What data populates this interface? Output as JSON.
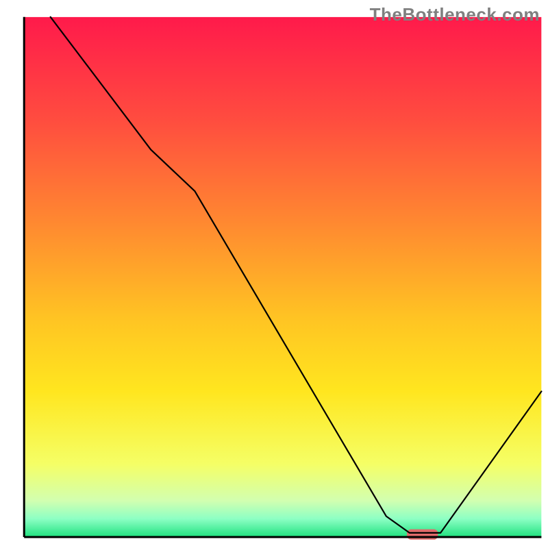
{
  "watermark": "TheBottleneck.com",
  "chart_data": {
    "type": "line",
    "title": "",
    "xlabel": "",
    "ylabel": "",
    "xlim": [
      0,
      100
    ],
    "ylim": [
      0,
      100
    ],
    "background_gradient": {
      "stops": [
        {
          "offset": 0.0,
          "color": "#ff1a4b"
        },
        {
          "offset": 0.2,
          "color": "#ff4d3f"
        },
        {
          "offset": 0.4,
          "color": "#ff8a30"
        },
        {
          "offset": 0.58,
          "color": "#ffc423"
        },
        {
          "offset": 0.72,
          "color": "#ffe61f"
        },
        {
          "offset": 0.86,
          "color": "#f5ff66"
        },
        {
          "offset": 0.93,
          "color": "#d2ffb0"
        },
        {
          "offset": 0.965,
          "color": "#8dffc4"
        },
        {
          "offset": 1.0,
          "color": "#1fe27f"
        }
      ]
    },
    "series": [
      {
        "name": "bottleneck-curve",
        "color": "#000000",
        "x": [
          5.1,
          24.5,
          33.0,
          70.0,
          74.5,
          80.5,
          100.0
        ],
        "values": [
          100.0,
          74.5,
          66.5,
          4.0,
          0.8,
          0.8,
          28.0
        ]
      }
    ],
    "marker": {
      "name": "optimal-range",
      "color": "#e06b6b",
      "x_start": 74.0,
      "x_end": 80.0,
      "y": 0.5,
      "height": 2.0
    },
    "axes": {
      "left": {
        "x": 4.4,
        "y0": 3.1,
        "y1": 98.0
      },
      "bottom": {
        "y": 98.0,
        "x0": 4.4,
        "x1": 98.8
      }
    }
  }
}
